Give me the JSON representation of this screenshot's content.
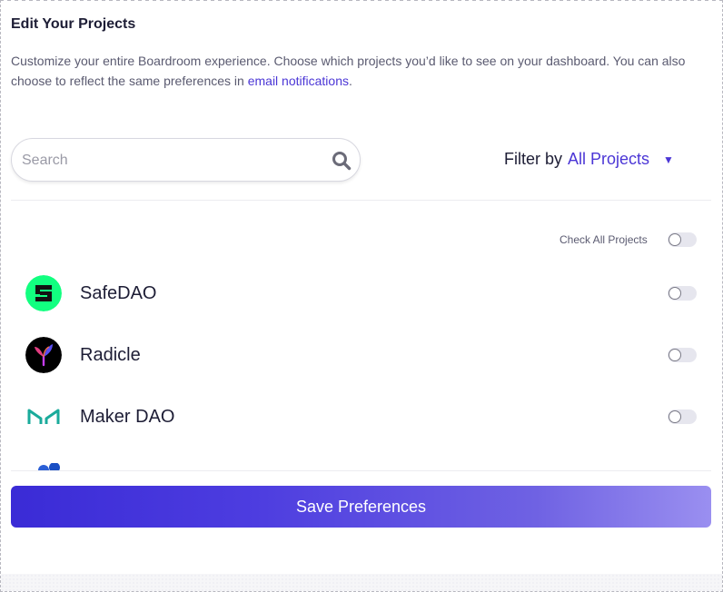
{
  "header": {
    "title": "Edit Your Projects",
    "description_prefix": "Customize your entire Boardroom experience. Choose which projects you’d like to see on your dashboard. You can also choose to reflect the same preferences in ",
    "description_link": "email notifications",
    "description_suffix": "."
  },
  "search": {
    "placeholder": "Search",
    "value": ""
  },
  "filter": {
    "label": "Filter by",
    "selected": "All Projects"
  },
  "check_all": {
    "label": "Check All Projects",
    "checked": false
  },
  "projects": [
    {
      "name": "SafeDAO",
      "icon": "safedao-logo",
      "checked": false,
      "color": "#12ff80"
    },
    {
      "name": "Radicle",
      "icon": "radicle-logo",
      "checked": false,
      "color": "#000000"
    },
    {
      "name": "Maker DAO",
      "icon": "makerdao-logo",
      "checked": false,
      "color": "#1aab9b"
    }
  ],
  "actions": {
    "save_label": "Save Preferences"
  },
  "colors": {
    "accent": "#4b36d6",
    "button_gradient_start": "#3a2bd6",
    "button_gradient_end": "#9a8ff0"
  }
}
